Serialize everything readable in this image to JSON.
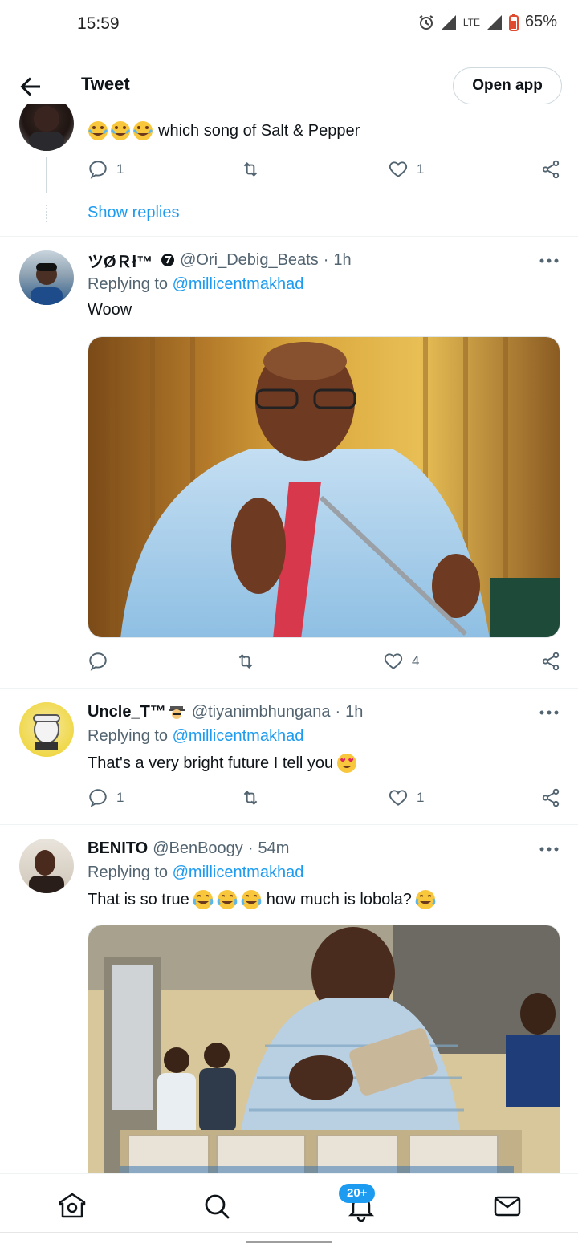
{
  "status_bar": {
    "time": "15:59",
    "network": "LTE",
    "battery": "65%"
  },
  "header": {
    "title": "Tweet",
    "open_app_label": "Open app",
    "back_icon": "arrow-left-icon"
  },
  "tweets": [
    {
      "text": "which song of Salt & Pepper",
      "text_emoji": "rolling-on-floor-laughing-emoji x3",
      "reply_count": "1",
      "retweet_count": "",
      "like_count": "1",
      "show_replies": "Show replies"
    },
    {
      "name": "ツØＲł™",
      "handle": "@Ori_Debig_Beats",
      "time": "1h",
      "replying_prefix": "Replying to",
      "replying_to": "@millicentmakhad",
      "text": "Woow",
      "reply_count": "",
      "retweet_count": "",
      "like_count": "4",
      "media": "photo"
    },
    {
      "name": "Uncle_T™",
      "handle": "@tiyanimbhungana",
      "time": "1h",
      "replying_prefix": "Replying to",
      "replying_to": "@millicentmakhad",
      "text": "That's a very bright future I tell you",
      "text_emoji": "heart-eyes-emoji",
      "reply_count": "1",
      "retweet_count": "",
      "like_count": "1"
    },
    {
      "name": "BENITO",
      "handle": "@BenBoogy",
      "time": "54m",
      "replying_prefix": "Replying to",
      "replying_to": "@millicentmakhad",
      "text_part1": "That is so true",
      "text_part2": "how much is lobola?",
      "text_emoji": "tears-of-joy-emoji",
      "media": "photo"
    }
  ],
  "bottom_nav": {
    "notifications_badge": "20+",
    "icons": [
      "home-icon",
      "search-icon",
      "notifications-icon",
      "messages-icon"
    ]
  },
  "colors": {
    "accent": "#1d9bf0",
    "text": "#0f1419",
    "secondary": "#536471",
    "divider": "#eff3f4"
  }
}
